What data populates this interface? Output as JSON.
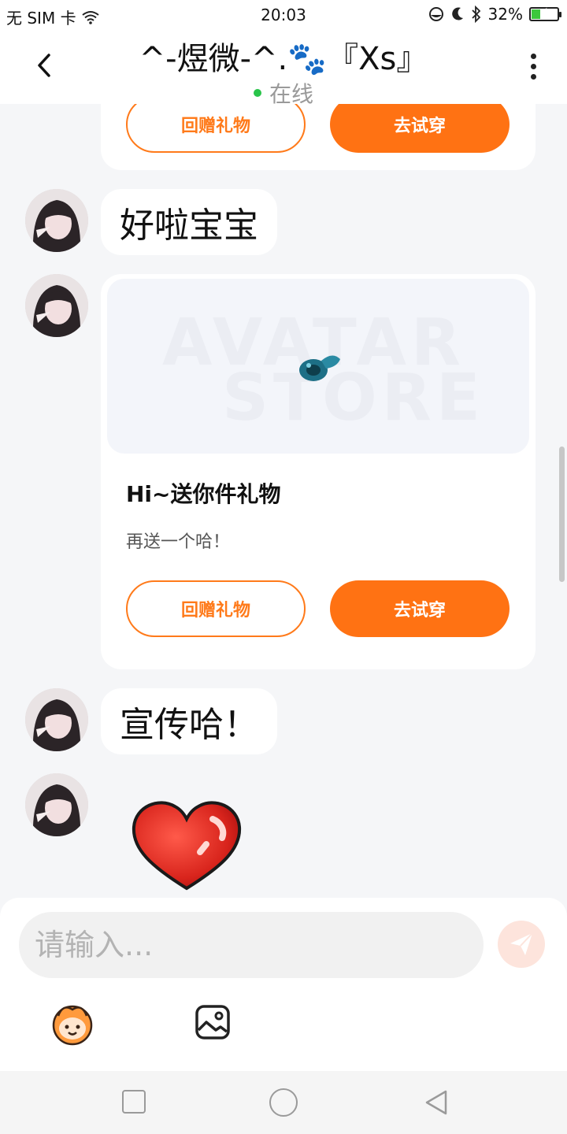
{
  "status_bar": {
    "carrier": "无 SIM 卡",
    "time": "20:03",
    "battery": "32%",
    "battery_level": 0.32
  },
  "header": {
    "title": "^-煜微-^.🐾『Xs』",
    "status": "在线"
  },
  "messages": {
    "top_card": {
      "return_gift_label": "回赠礼物",
      "try_on_label": "去试穿"
    },
    "text1": "好啦宝宝",
    "gift_card": {
      "watermark_line1": "AVATAR",
      "watermark_line2": "STORE",
      "title": "Hi~送你件礼物",
      "description": "再送一个哈！",
      "return_gift_label": "回赠礼物",
      "try_on_label": "去试穿"
    },
    "text2": "宣传哈！"
  },
  "input": {
    "placeholder": "请输入..."
  },
  "colors": {
    "accent": "#ff7213",
    "online": "#29c44a",
    "send_bg": "#fde4dc"
  },
  "icons": [
    "back-icon",
    "more-icon",
    "wifi-icon",
    "moon-icon",
    "bluetooth-icon",
    "send-icon",
    "emoji-icon",
    "image-icon",
    "heart-sticker"
  ]
}
